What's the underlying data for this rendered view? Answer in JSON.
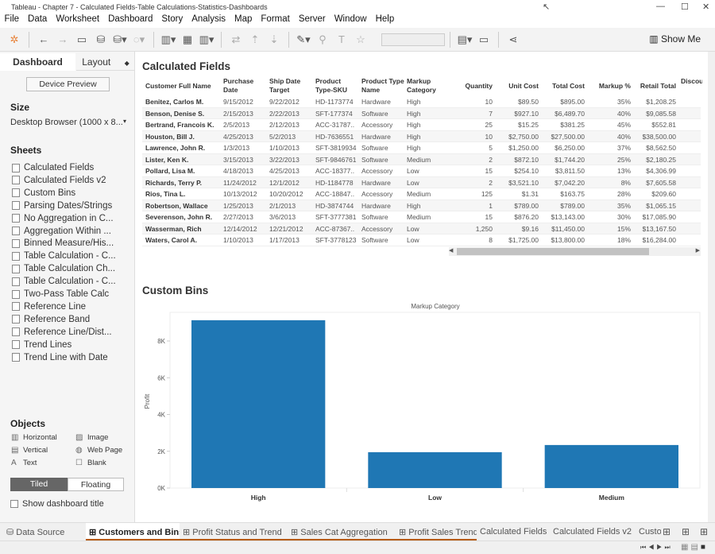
{
  "window": {
    "title": "Tableau - Chapter 7 - Calculated Fields-Table Calculations-Statistics-Dashboards"
  },
  "menu": [
    "File",
    "Data",
    "Worksheet",
    "Dashboard",
    "Story",
    "Analysis",
    "Map",
    "Format",
    "Server",
    "Window",
    "Help"
  ],
  "toolbar": {
    "show_me": "Show Me"
  },
  "left": {
    "tabs": {
      "dashboard": "Dashboard",
      "layout": "Layout"
    },
    "device_preview": "Device Preview",
    "size_title": "Size",
    "size_value": "Desktop Browser (1000 x 8...",
    "sheets_title": "Sheets",
    "sheets": [
      "Calculated Fields",
      "Calculated Fields v2",
      "Custom Bins",
      "Parsing Dates/Strings",
      "No Aggregation in C...",
      "Aggregation Within ...",
      "Binned Measure/His...",
      "Table Calculation - C...",
      "Table Calculation Ch...",
      "Table Calculation - C...",
      "Two-Pass Table Calc",
      "Reference Line",
      "Reference Band",
      "Reference Line/Dist...",
      "Trend Lines",
      "Trend Line with Date"
    ],
    "objects_title": "Objects",
    "objects": [
      {
        "label": "Horizontal",
        "icon": "horizontal-icon"
      },
      {
        "label": "Image",
        "icon": "image-icon"
      },
      {
        "label": "Vertical",
        "icon": "vertical-icon"
      },
      {
        "label": "Web Page",
        "icon": "web-page-icon"
      },
      {
        "label": "Text",
        "icon": "text-icon"
      },
      {
        "label": "Blank",
        "icon": "blank-icon"
      }
    ],
    "tiled": "Tiled",
    "floating": "Floating",
    "show_title": "Show dashboard title"
  },
  "table": {
    "title": "Calculated Fields",
    "headers": [
      "Customer Full Name",
      "Purchase Date",
      "Ship Date Target",
      "Product Type-SKU",
      "Product Type Name",
      "Markup Category",
      "Quantity",
      "Unit Cost",
      "Total Cost",
      "Markup %",
      "Retail Total",
      "Discount Numer"
    ],
    "rows": [
      [
        "Benitez, Carlos M.",
        "9/15/2012",
        "9/22/2012",
        "HD-1173774",
        "Hardware",
        "High",
        "10",
        "$89.50",
        "$895.00",
        "35%",
        "$1,208.25"
      ],
      [
        "Benson, Denise S.",
        "2/15/2013",
        "2/22/2013",
        "SFT-177374",
        "Software",
        "High",
        "7",
        "$927.10",
        "$6,489.70",
        "40%",
        "$9,085.58"
      ],
      [
        "Bertrand, Francois K.",
        "2/5/2013",
        "2/12/2013",
        "ACC-31787..",
        "Accessory",
        "High",
        "25",
        "$15.25",
        "$381.25",
        "45%",
        "$552.81"
      ],
      [
        "Houston, Bill J.",
        "4/25/2013",
        "5/2/2013",
        "HD-7636551",
        "Hardware",
        "High",
        "10",
        "$2,750.00",
        "$27,500.00",
        "40%",
        "$38,500.00"
      ],
      [
        "Lawrence, John R.",
        "1/3/2013",
        "1/10/2013",
        "SFT-3819934",
        "Software",
        "High",
        "5",
        "$1,250.00",
        "$6,250.00",
        "37%",
        "$8,562.50"
      ],
      [
        "Lister, Ken K.",
        "3/15/2013",
        "3/22/2013",
        "SFT-9846761",
        "Software",
        "Medium",
        "2",
        "$872.10",
        "$1,744.20",
        "25%",
        "$2,180.25"
      ],
      [
        "Pollard, Lisa M.",
        "4/18/2013",
        "4/25/2013",
        "ACC-18377..",
        "Accessory",
        "Low",
        "15",
        "$254.10",
        "$3,811.50",
        "13%",
        "$4,306.99"
      ],
      [
        "Richards, Terry P.",
        "11/24/2012",
        "12/1/2012",
        "HD-1184778",
        "Hardware",
        "Low",
        "2",
        "$3,521.10",
        "$7,042.20",
        "8%",
        "$7,605.58"
      ],
      [
        "Rios, Tina L.",
        "10/13/2012",
        "10/20/2012",
        "ACC-18847..",
        "Accessory",
        "Medium",
        "125",
        "$1.31",
        "$163.75",
        "28%",
        "$209.60"
      ],
      [
        "Robertson, Wallace",
        "1/25/2013",
        "2/1/2013",
        "HD-3874744",
        "Hardware",
        "High",
        "1",
        "$789.00",
        "$789.00",
        "35%",
        "$1,065.15"
      ],
      [
        "Severenson, John R.",
        "2/27/2013",
        "3/6/2013",
        "SFT-3777381",
        "Software",
        "Medium",
        "15",
        "$876.20",
        "$13,143.00",
        "30%",
        "$17,085.90"
      ],
      [
        "Wasserman, Rich",
        "12/14/2012",
        "12/21/2012",
        "ACC-87367..",
        "Accessory",
        "Low",
        "1,250",
        "$9.16",
        "$11,450.00",
        "15%",
        "$13,167.50"
      ],
      [
        "Waters, Carol A.",
        "1/10/2013",
        "1/17/2013",
        "SFT-3778123",
        "Software",
        "Low",
        "8",
        "$1,725.00",
        "$13,800.00",
        "18%",
        "$16,284.00"
      ]
    ]
  },
  "chart_section_title": "Custom Bins",
  "chart_data": {
    "type": "bar",
    "title": "Markup Category",
    "categories": [
      "High",
      "Low",
      "Medium"
    ],
    "values": [
      9130,
      1950,
      2340
    ],
    "xlabel": "",
    "ylabel": "Profit",
    "yticks": [
      "0K",
      "2K",
      "4K",
      "6K",
      "8K"
    ],
    "ylim": [
      0,
      9500
    ],
    "color": "#1f77b4",
    "grid": false
  },
  "tabs": [
    "Data Source",
    "Customers and Bins",
    "Profit Status and Trend",
    "Sales Cat Aggregation",
    "Profit Sales Trend",
    "Calculated Fields",
    "Calculated Fields v2",
    "Custo"
  ],
  "accent": "#b65b0e"
}
